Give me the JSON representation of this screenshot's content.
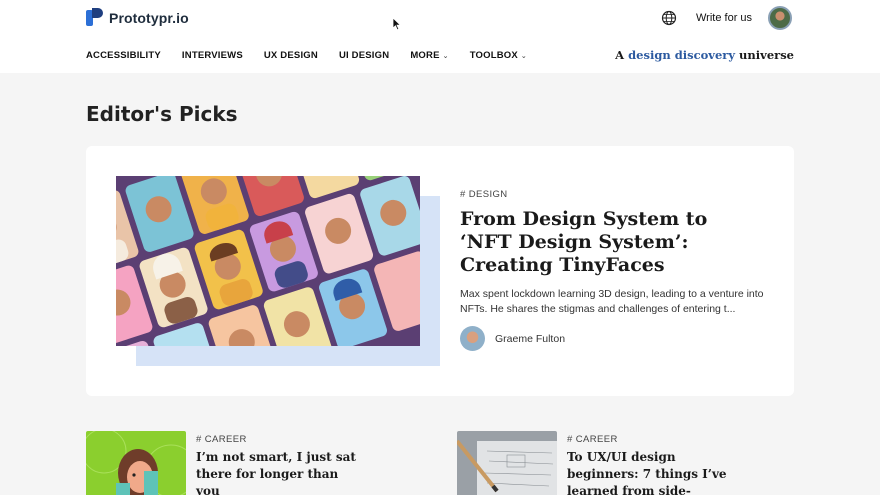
{
  "brand": {
    "name": "Prototypr.io"
  },
  "header": {
    "write_label": "Write for us"
  },
  "nav": {
    "items": [
      {
        "label": "ACCESSIBILITY",
        "dropdown": false
      },
      {
        "label": "INTERVIEWS",
        "dropdown": false
      },
      {
        "label": "UX DESIGN",
        "dropdown": false
      },
      {
        "label": "UI DESIGN",
        "dropdown": false
      },
      {
        "label": "MORE",
        "dropdown": true
      },
      {
        "label": "TOOLBOX",
        "dropdown": true
      }
    ],
    "tagline": {
      "pre": "A",
      "highlight": "design discovery",
      "post": "universe"
    }
  },
  "section": {
    "title": "Editor's Picks"
  },
  "featured": {
    "tag": "# DESIGN",
    "title": "From Design System to ‘NFT Design System’: Creating TinyFaces",
    "description": "Max spent lockdown learning 3D design, leading to a venture into NFTs. He shares the stigmas and challenges of entering t...",
    "author": "Graeme Fulton"
  },
  "cards": [
    {
      "tag": "# CAREER",
      "title": "I’m not smart, I just sat there for longer than you"
    },
    {
      "tag": "# CAREER",
      "title": "To UX/UI design beginners: 7 things I’ve learned from side-"
    }
  ],
  "colors": {
    "accent": "#2c5aa0",
    "card_bg": "#ffffff",
    "page_bg": "#f5f5f5",
    "image_shadow": "#d6e3f7"
  },
  "icons": {
    "globe": "globe-icon",
    "chevron": "chevron-down-icon",
    "cursor": "mouse-cursor-icon"
  }
}
